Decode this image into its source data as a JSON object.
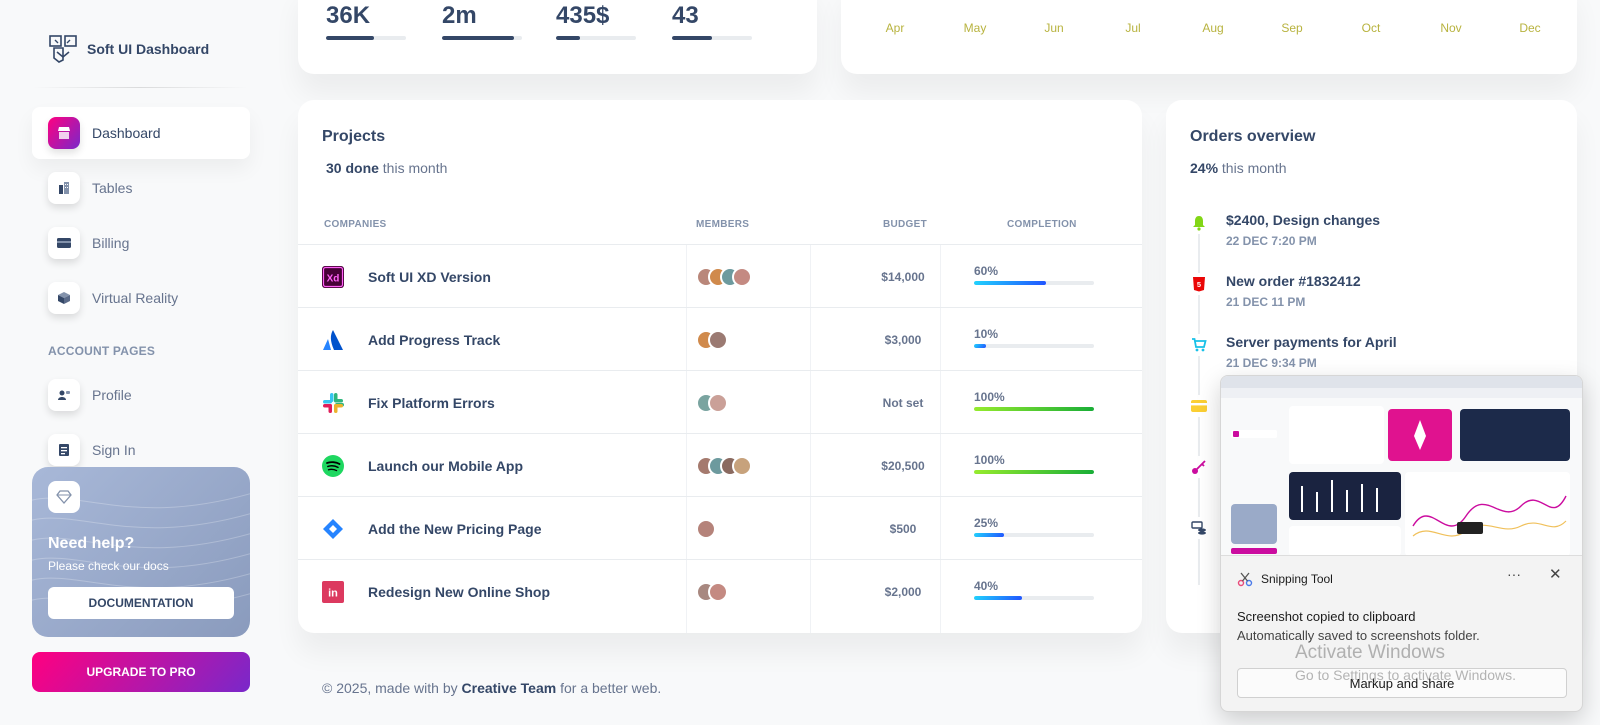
{
  "brand": {
    "name": "Soft UI Dashboard"
  },
  "sidebar": {
    "items": [
      {
        "label": "Dashboard",
        "icon": "shop-icon"
      },
      {
        "label": "Tables",
        "icon": "office-icon"
      },
      {
        "label": "Billing",
        "icon": "credit-card-icon"
      },
      {
        "label": "Virtual Reality",
        "icon": "box-3d-icon"
      }
    ],
    "section_title": "ACCOUNT PAGES",
    "account_items": [
      {
        "label": "Profile",
        "icon": "customer-support-icon"
      },
      {
        "label": "Sign In",
        "icon": "document-icon"
      }
    ],
    "help": {
      "title": "Need help?",
      "subtitle": "Please check our docs",
      "button": "DOCUMENTATION"
    },
    "upgrade": "UPGRADE TO PRO"
  },
  "stats": [
    {
      "value": "36K",
      "progress": 0.6
    },
    {
      "value": "2m",
      "progress": 0.9
    },
    {
      "value": "435$",
      "progress": 0.3
    },
    {
      "value": "43",
      "progress": 0.5
    }
  ],
  "months": [
    "Apr",
    "May",
    "Jun",
    "Jul",
    "Aug",
    "Sep",
    "Oct",
    "Nov",
    "Dec"
  ],
  "projects": {
    "title": "Projects",
    "done_count": "30 done",
    "done_suffix": "this month",
    "headers": [
      "COMPANIES",
      "MEMBERS",
      "BUDGET",
      "COMPLETION"
    ],
    "rows": [
      {
        "company": "Soft UI XD Version",
        "logo": "adobe-xd-icon",
        "members": 4,
        "budget": "$14,000",
        "completion": "60%",
        "pct": 60
      },
      {
        "company": "Add Progress Track",
        "logo": "atlassian-icon",
        "members": 2,
        "budget": "$3,000",
        "completion": "10%",
        "pct": 10
      },
      {
        "company": "Fix Platform Errors",
        "logo": "slack-icon",
        "members": 2,
        "budget": "Not set",
        "completion": "100%",
        "pct": 100
      },
      {
        "company": "Launch our Mobile App",
        "logo": "spotify-icon",
        "members": 4,
        "budget": "$20,500",
        "completion": "100%",
        "pct": 100
      },
      {
        "company": "Add the New Pricing Page",
        "logo": "jira-icon",
        "members": 1,
        "budget": "$500",
        "completion": "25%",
        "pct": 25
      },
      {
        "company": "Redesign New Online Shop",
        "logo": "invision-icon",
        "members": 2,
        "budget": "$2,000",
        "completion": "40%",
        "pct": 40
      }
    ]
  },
  "orders": {
    "title": "Orders overview",
    "pct": "24%",
    "suffix": "this month",
    "items": [
      {
        "title": "$2400, Design changes",
        "date": "22 DEC 7:20 PM",
        "icon": "bell-icon",
        "color": "#82d616"
      },
      {
        "title": "New order #1832412",
        "date": "21 DEC 11 PM",
        "icon": "html5-icon",
        "color": "#ea0606"
      },
      {
        "title": "Server payments for April",
        "date": "21 DEC 9:34 PM",
        "icon": "cart-icon",
        "color": "#17c1e8"
      },
      {
        "title": "",
        "date": "",
        "icon": "credit-card-icon",
        "color": "#fbcf33"
      },
      {
        "title": "",
        "date": "",
        "icon": "key-icon",
        "color": "#cb0c9f"
      },
      {
        "title": "",
        "date": "",
        "icon": "money-coins-icon",
        "color": "#344767"
      }
    ]
  },
  "footer": {
    "prefix": "© 2025, made with by",
    "team": "Creative Team",
    "suffix": "for a better web."
  },
  "snipping": {
    "app": "Snipping Tool",
    "more": "···",
    "close": "✕",
    "message": "Screenshot copied to clipboard",
    "detail": "Automatically saved to screenshots folder.",
    "button": "Markup and share"
  },
  "watermark": {
    "line1": "Activate Windows",
    "line2": "Go to Settings to activate Windows."
  },
  "colors": {
    "accent": "#cb0c9f",
    "text": "#344767",
    "muted": "#67748e"
  }
}
